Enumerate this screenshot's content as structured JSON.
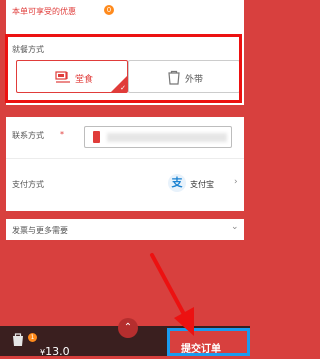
{
  "promo": {
    "text": "本单可享受的优惠",
    "count": "0"
  },
  "dining": {
    "label": "就餐方式",
    "options": [
      {
        "label": "堂食",
        "selected": true
      },
      {
        "label": "外带",
        "selected": false
      }
    ]
  },
  "contact": {
    "label": "联系方式",
    "required": "*"
  },
  "payment": {
    "label": "支付方式",
    "method": "支付宝",
    "icon_glyph": "支"
  },
  "invoice": {
    "label": "发票与更多需要"
  },
  "cart": {
    "badge": "1",
    "currency": "¥",
    "total": "13.0"
  },
  "submit": {
    "label": "提交订单"
  },
  "colors": {
    "accent": "#e03c3a",
    "highlight_red": "#ec1111",
    "highlight_blue": "#1a9bf0",
    "bar": "#3a1f1f"
  },
  "icons": {
    "check": "✓",
    "chevron_right": "›",
    "chevron_down": "⌄",
    "chevron_up": "⌃"
  }
}
